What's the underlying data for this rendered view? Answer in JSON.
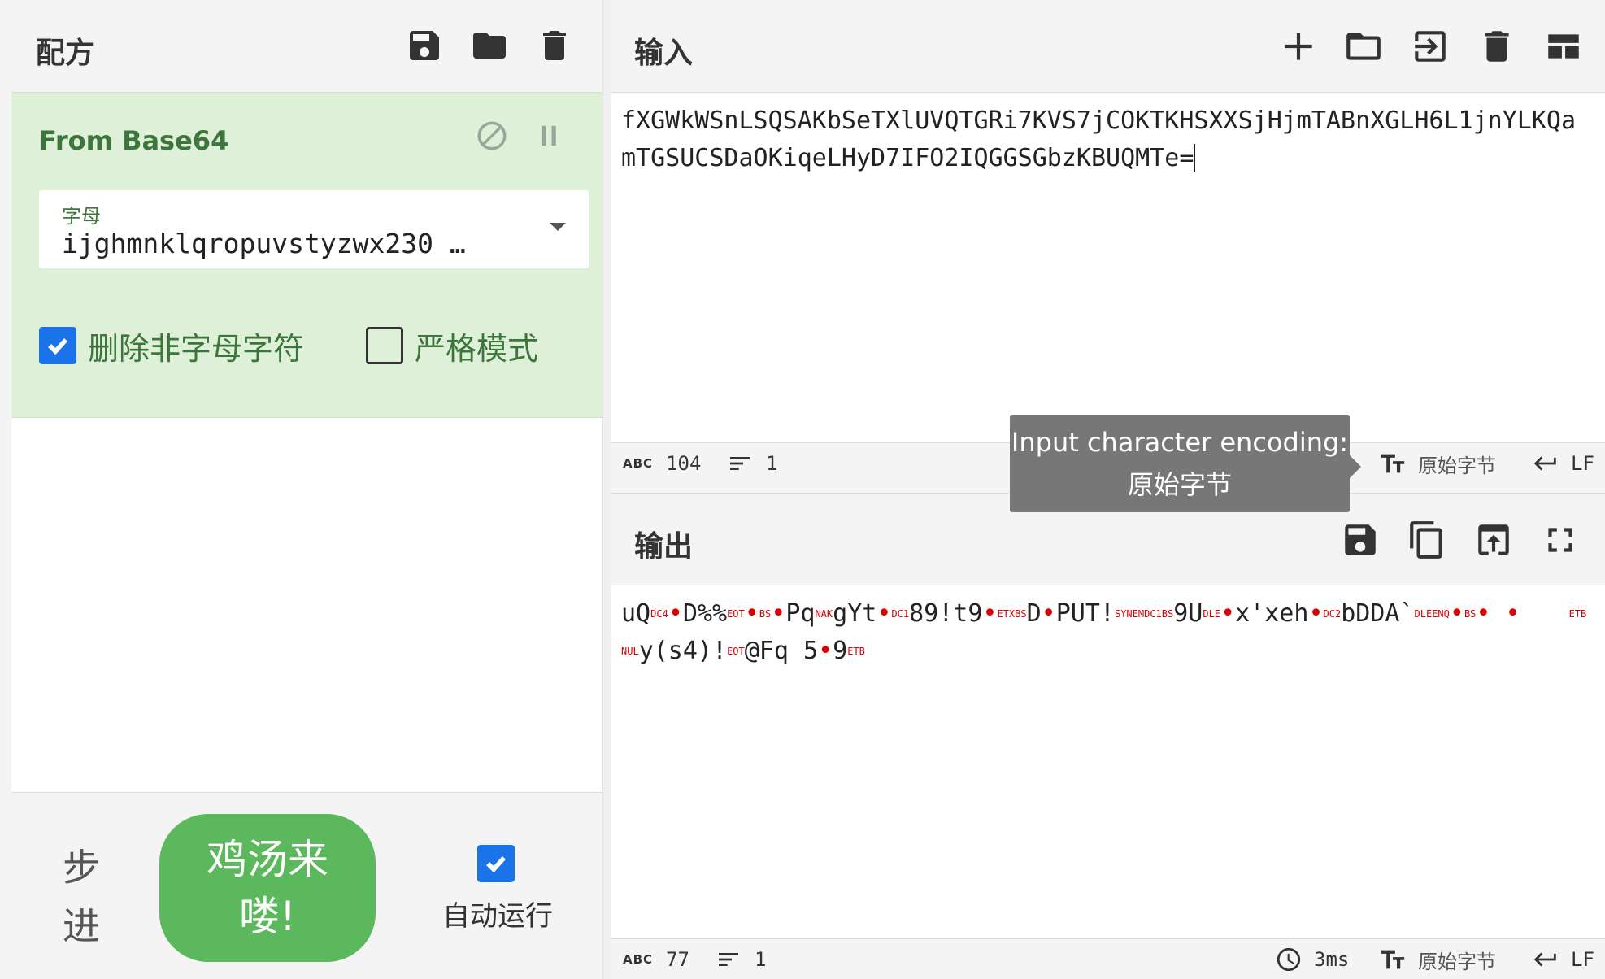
{
  "recipe": {
    "title": "配方",
    "operation": {
      "name": "From Base64",
      "alphabet_label": "字母",
      "alphabet_value": "ijghmnklqropuvstyzwx230 …",
      "remove_nonalpha_label": "删除非字母字符",
      "remove_nonalpha_checked": true,
      "strict_mode_label": "严格模式",
      "strict_mode_checked": false
    },
    "step_label_1": "步",
    "step_label_2": "进",
    "bake_label_1": "鸡汤来",
    "bake_label_2": "喽!",
    "auto_bake_label": "自动运行",
    "auto_bake_checked": true
  },
  "input": {
    "title": "输入",
    "text_line1": "fXGWkWSnLSQSAKbSeTXlUVQTGRi7KVS7jCOKTKHSXXSjHjmTABnXGLH6L1jnYLKQa",
    "text_line2": "mTGSUCSDaOKiqeLHyD7IFO2IQGGSGbzKBUQMTe=",
    "status": {
      "abc": "ABC",
      "length": "104",
      "lines": "1",
      "encoding": "原始字节",
      "eol": "LF"
    }
  },
  "tooltip": {
    "line1": "Input character encoding:",
    "line2": "原始字节"
  },
  "output": {
    "title": "输出",
    "seg": {
      "a": "uQ",
      "c1": "DC4",
      "b": "D%%",
      "c2": "EOT",
      "c3": "BS",
      "d": "Pq",
      "c4": "NAK",
      "e": "gYt",
      "c5": "DC1",
      "f": "89!t9",
      "c6": "ETX",
      "c7": "BS",
      "g": "D",
      "h": "PUT!",
      "c8": "SYN",
      "c9": "EM",
      "c10": "DC1",
      "c11": "BS",
      "i": "9U",
      "c12": "DLE",
      "j": "x'xeh",
      "c13": "DC2",
      "k": "bDDA`",
      "c14": "DLE",
      "c15": "ENQ",
      "c16": "BS",
      "c17": "ETB",
      "c18": "NUL",
      "l": "y(s4)!",
      "c19": "EOT",
      "m": "@Fq 5",
      "n": "9",
      "c20": "ETB"
    },
    "status": {
      "abc": "ABC",
      "length": "77",
      "lines": "1",
      "time": "3ms",
      "encoding": "原始字节",
      "eol": "LF"
    }
  }
}
